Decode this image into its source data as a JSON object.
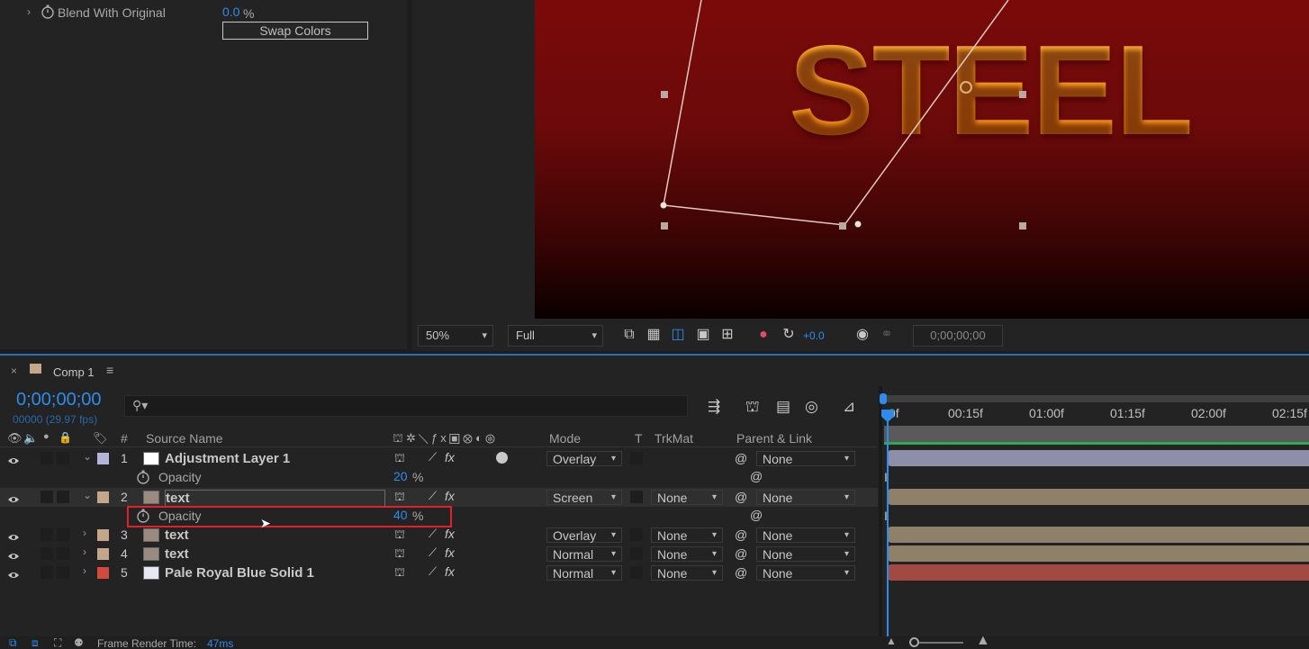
{
  "effect_controls": {
    "blend_label": "Blend With Original",
    "blend_value": "0.0",
    "blend_unit": "%",
    "swap_button": "Swap Colors"
  },
  "viewer": {
    "headline": "STEEL",
    "zoom": "50%",
    "resolution": "Full",
    "exposure": "+0.0",
    "timecode": "0;00;00;00"
  },
  "timeline": {
    "tab_close": "×",
    "comp_name": "Comp 1",
    "menu_icon": "≡",
    "current_time": "0;00;00;00",
    "frame_info": "00000 (29.97 fps)",
    "search_placeholder": "",
    "columns": {
      "hash": "#",
      "source_name": "Source Name",
      "mode": "Mode",
      "t": "T",
      "trkmat": "TrkMat",
      "parent": "Parent & Link"
    },
    "ruler": [
      "0f",
      "00:15f",
      "01:00f",
      "01:15f",
      "02:00f",
      "02:15f"
    ],
    "layers": [
      {
        "num": "1",
        "name": "Adjustment Layer 1",
        "color": "#b4b4d9",
        "mode": "Overlay",
        "trkmat": "",
        "parent": "None",
        "bar_color": "#8e8ea8"
      },
      {
        "num": "2",
        "name": "text",
        "color": "#c4a78a",
        "mode": "Screen",
        "trkmat": "None",
        "parent": "None",
        "bar_color": "#8f806a"
      },
      {
        "num": "3",
        "name": "text",
        "color": "#c4a78a",
        "mode": "Overlay",
        "trkmat": "None",
        "parent": "None",
        "bar_color": "#8f806a"
      },
      {
        "num": "4",
        "name": "text",
        "color": "#c4a78a",
        "mode": "Normal",
        "trkmat": "None",
        "parent": "None",
        "bar_color": "#8f806a"
      },
      {
        "num": "5",
        "name": "Pale Royal Blue Solid 1",
        "color": "#d24a3c",
        "mode": "Normal",
        "trkmat": "None",
        "parent": "None",
        "bar_color": "#a14a44"
      }
    ],
    "opacity_rows": [
      {
        "label": "Opacity",
        "value": "20",
        "unit": "%"
      },
      {
        "label": "Opacity",
        "value": "40",
        "unit": "%"
      }
    ],
    "footer": {
      "label": "Frame Render Time:",
      "value": "47ms"
    },
    "colors": {
      "accent": "#2d8ceb",
      "highlight_box": "#e0202a",
      "work_area": "#2fa84f"
    }
  }
}
